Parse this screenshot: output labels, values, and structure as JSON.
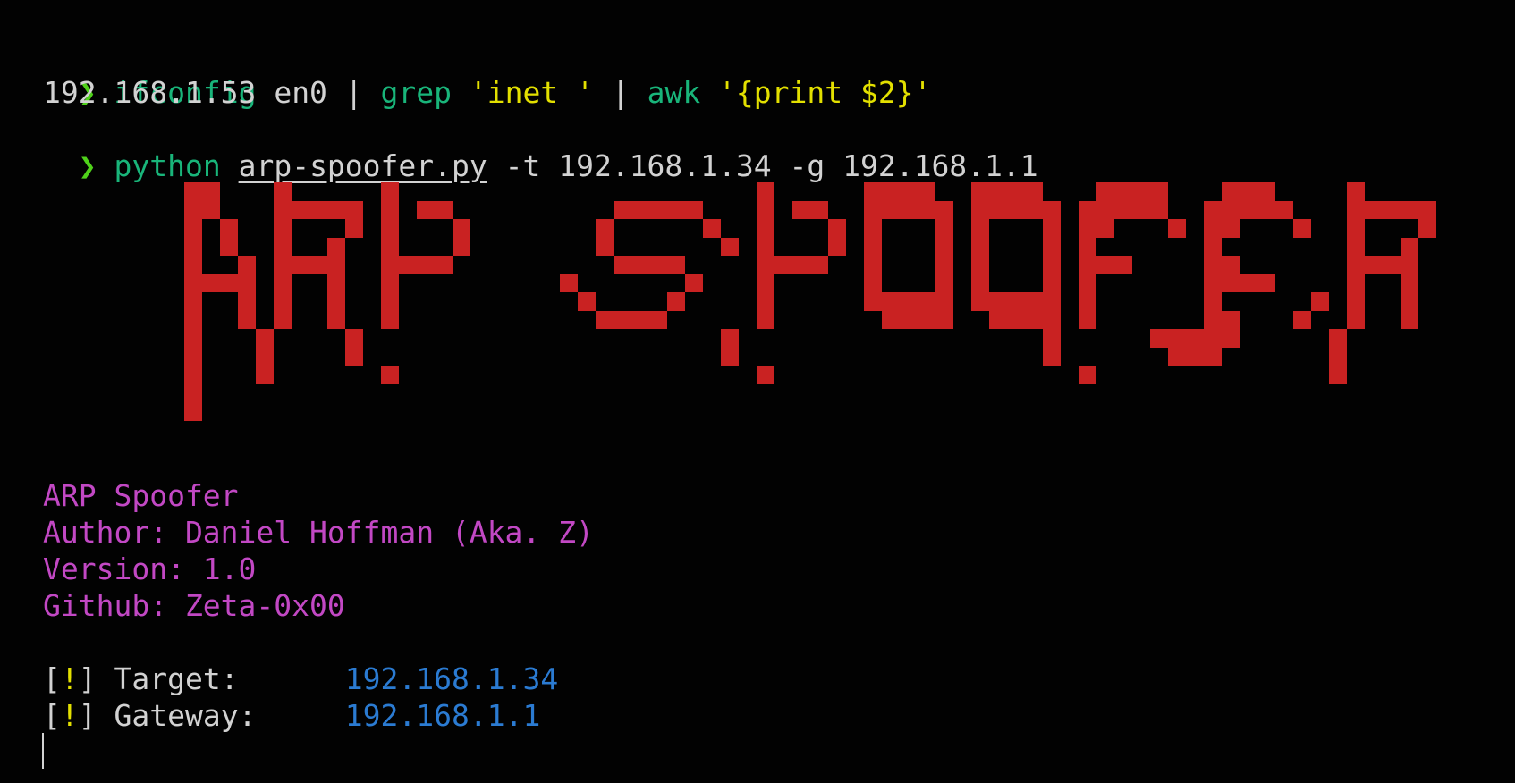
{
  "terminal": {
    "prompt_symbol": "❯",
    "commands": [
      {
        "parts": [
          {
            "text": "ifconfig",
            "kind": "cmd"
          },
          {
            "text": " en0 ",
            "kind": "plain"
          },
          {
            "text": "|",
            "kind": "plain"
          },
          {
            "text": " grep ",
            "kind": "cmd"
          },
          {
            "text": "'inet '",
            "kind": "str"
          },
          {
            "text": " | ",
            "kind": "plain"
          },
          {
            "text": "awk ",
            "kind": "cmd"
          },
          {
            "text": "'{print $2}'",
            "kind": "str"
          }
        ],
        "output": "192.168.1.53"
      },
      {
        "parts": [
          {
            "text": "python",
            "kind": "cmd"
          },
          {
            "text": " ",
            "kind": "plain"
          },
          {
            "text": "arp-spoofer.py",
            "kind": "file"
          },
          {
            "text": " -t 192.168.1.34 -g 192.168.1.1",
            "kind": "plain"
          }
        ]
      }
    ],
    "banner_text": "ARP SPOOFER",
    "info": {
      "title": "ARP Spoofer",
      "author": "Author: Daniel Hoffman (Aka. Z)",
      "version": "Version: 1.0",
      "github": "Github: Zeta-0x00"
    },
    "status": [
      {
        "open": "[",
        "mark": "!",
        "close": "]",
        "label": " Target:      ",
        "value": "192.168.1.34"
      },
      {
        "open": "[",
        "mark": "!",
        "close": "]",
        "label": " Gateway:     ",
        "value": "192.168.1.1"
      }
    ],
    "colors": {
      "background": "#020202",
      "prompt": "#4fd11a",
      "command": "#19b57a",
      "string": "#e3e000",
      "banner": "#c92222",
      "info": "#c248c4",
      "value": "#2b7bd2"
    }
  }
}
